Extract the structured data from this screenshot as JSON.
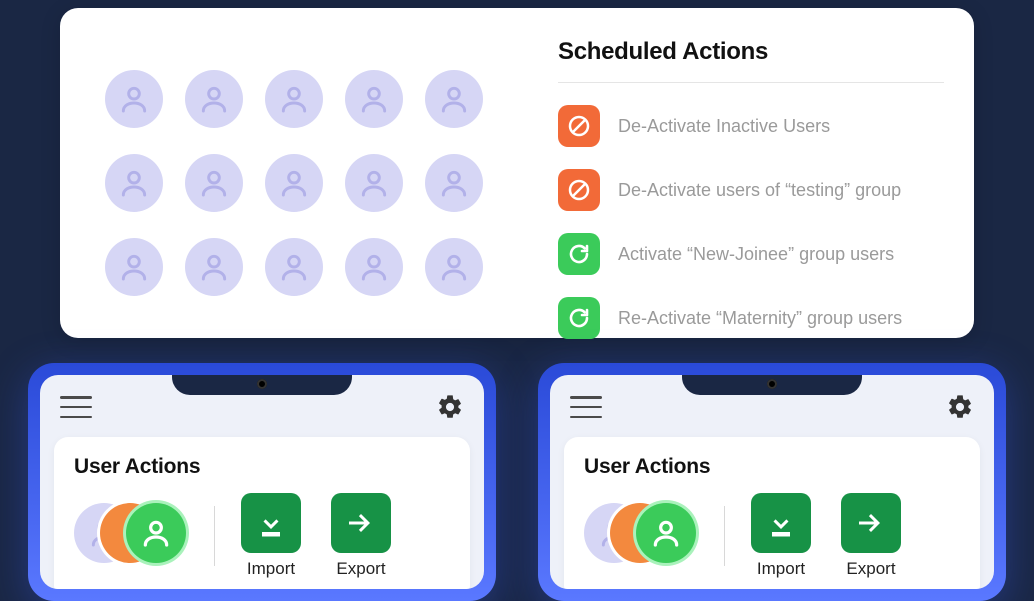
{
  "scheduled": {
    "title": "Scheduled Actions",
    "items": [
      {
        "type": "deactivate",
        "label": "De-Activate Inactive Users"
      },
      {
        "type": "deactivate",
        "label": "De-Activate users of “testing” group"
      },
      {
        "type": "activate",
        "label": "Activate “New-Joinee” group users"
      },
      {
        "type": "activate",
        "label": "Re-Activate “Maternity” group users"
      }
    ]
  },
  "userActions": {
    "title": "User Actions",
    "import_label": "Import",
    "export_label": "Export"
  },
  "avatar_grid_count": 15,
  "colors": {
    "deactivate": "#f26a38",
    "activate": "#3bcb5a",
    "action_button": "#179246",
    "avatar_bg": "#d6d6f5"
  }
}
